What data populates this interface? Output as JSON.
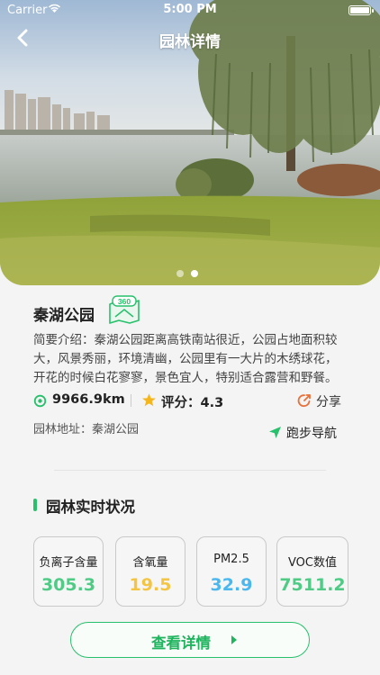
{
  "status_bar": {
    "carrier": "Carrier",
    "time": "5:00 PM"
  },
  "nav": {
    "title": "园林详情"
  },
  "gallery": {
    "page_count": 2,
    "active_index": 1
  },
  "park": {
    "name": "秦湖公园",
    "vr_badge": "360",
    "intro": "简要介绍：秦湖公园距离高铁南站很近，公园占地面积较大，风景秀丽，环境清幽，公园里有一大片的木绣球花，开花的时候白花寥寥，景色宜人，特别适合露营和野餐。",
    "distance": "9966.9km",
    "score_text": "评分：4.3",
    "share_label": "分享",
    "address": "园林地址：秦湖公园",
    "navigate_label": "跑步导航"
  },
  "status_section": {
    "title": "园林实时状况",
    "cards": [
      {
        "label": "负离子含量",
        "value": "305.3",
        "color": "#4fcb86"
      },
      {
        "label": "含氧量",
        "value": "19.5",
        "color": "#f4c542"
      },
      {
        "label": "PM2.5",
        "value": "32.9",
        "color": "#4ab7ee"
      },
      {
        "label": "VOC数值",
        "value": "7511.2",
        "color": "#4fcb86"
      }
    ]
  },
  "detail_button": {
    "label": "查看详情"
  },
  "colors": {
    "accent": "#27c06b",
    "share_icon": "#e8703a"
  }
}
